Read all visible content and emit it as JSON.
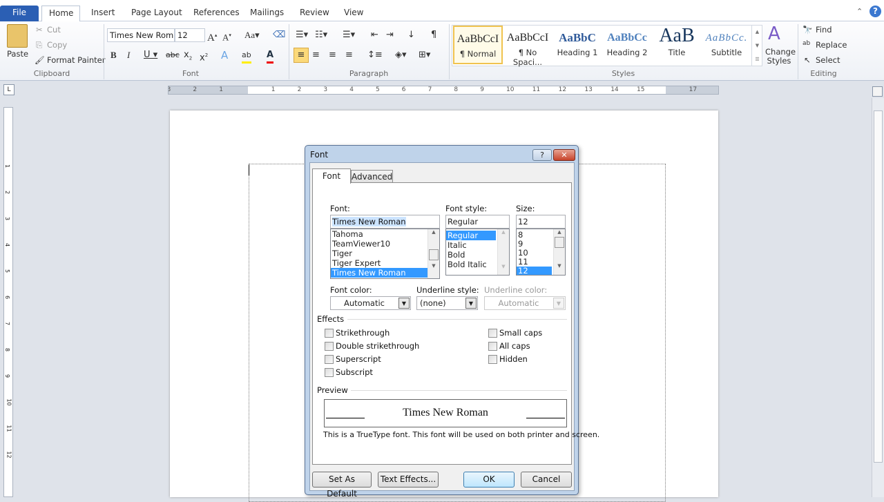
{
  "ribbon_tabs": [
    "File",
    "Home",
    "Insert",
    "Page Layout",
    "References",
    "Mailings",
    "Review",
    "View"
  ],
  "clipboard": {
    "paste": "Paste",
    "cut": "Cut",
    "copy": "Copy",
    "format_painter": "Format Painter",
    "label": "Clipboard"
  },
  "font_group": {
    "font_name": "Times New Rom",
    "font_size": "12",
    "label": "Font"
  },
  "paragraph": {
    "label": "Paragraph"
  },
  "styles": {
    "items": [
      {
        "sample": "AaBbCcI",
        "name": "¶ Normal"
      },
      {
        "sample": "AaBbCcI",
        "name": "¶ No Spaci..."
      },
      {
        "sample": "AaBbC",
        "name": "Heading 1"
      },
      {
        "sample": "AaBbCc",
        "name": "Heading 2"
      },
      {
        "sample": "AaB",
        "name": "Title"
      },
      {
        "sample": "AaBbCc.",
        "name": "Subtitle"
      }
    ],
    "change_styles": "Change Styles",
    "label": "Styles"
  },
  "editing": {
    "find": "Find",
    "replace": "Replace",
    "select": "Select",
    "label": "Editing"
  },
  "ruler_ticks": [
    "3",
    "2",
    "1",
    "1",
    "2",
    "3",
    "4",
    "5",
    "6",
    "7",
    "8",
    "9",
    "10",
    "11",
    "12",
    "13",
    "14",
    "15",
    "17"
  ],
  "vruler_ticks": [
    "1",
    "2",
    "3",
    "4",
    "5",
    "6",
    "7",
    "8",
    "9",
    "10",
    "11",
    "12"
  ],
  "dialog": {
    "title": "Font",
    "help": "?",
    "close": "✕",
    "tabs": [
      "Font",
      "Advanced"
    ],
    "font_label": "Font:",
    "font_value": "Times New Roman",
    "font_list": [
      "Tahoma",
      "TeamViewer10",
      "Tiger",
      "Tiger Expert",
      "Times New Roman"
    ],
    "style_label": "Font style:",
    "style_value": "Regular",
    "style_list": [
      "Regular",
      "Italic",
      "Bold",
      "Bold Italic"
    ],
    "size_label": "Size:",
    "size_value": "12",
    "size_list": [
      "8",
      "9",
      "10",
      "11",
      "12"
    ],
    "font_color_label": "Font color:",
    "font_color_value": "Automatic",
    "underline_style_label": "Underline style:",
    "underline_style_value": "(none)",
    "underline_color_label": "Underline color:",
    "underline_color_value": "Automatic",
    "effects_label": "Effects",
    "effects_left": [
      "Strikethrough",
      "Double strikethrough",
      "Superscript",
      "Subscript"
    ],
    "effects_right": [
      "Small caps",
      "All caps",
      "Hidden"
    ],
    "preview_label": "Preview",
    "preview_text": "Times New Roman",
    "preview_note": "This is a TrueType font. This font will be used on both printer and screen.",
    "set_default": "Set As Default",
    "text_effects": "Text Effects...",
    "ok": "OK",
    "cancel": "Cancel"
  }
}
